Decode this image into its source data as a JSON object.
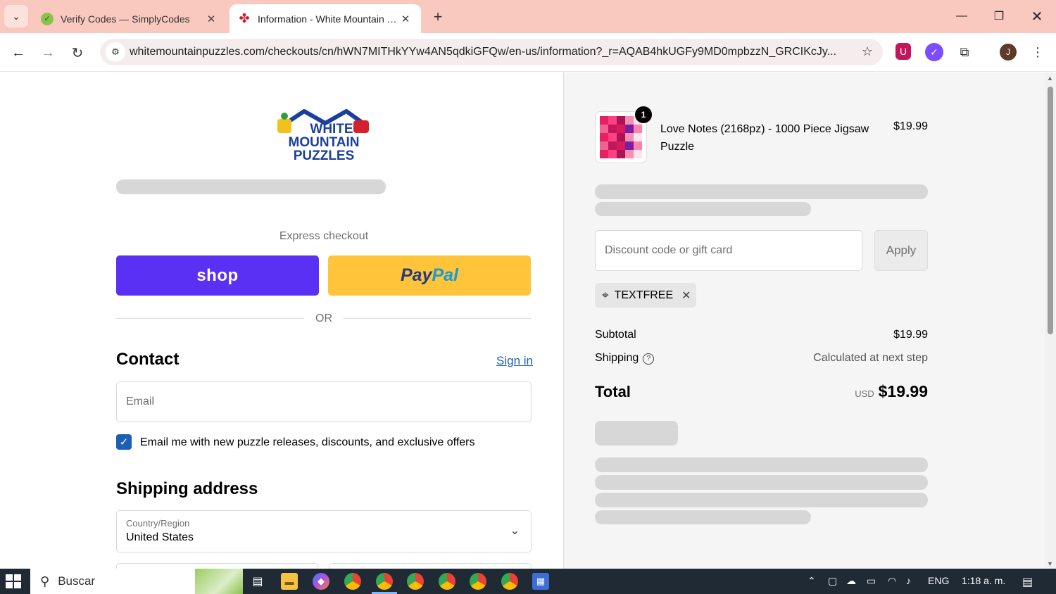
{
  "browser": {
    "tabs": [
      {
        "title": "Verify Codes — SimplyCodes",
        "active": false
      },
      {
        "title": "Information - White Mountain Puzzles",
        "active": true
      }
    ],
    "url": "whitemountainpuzzles.com/checkouts/cn/hWN7MITHkYYw4AN5qdkiGFQw/en-us/information?_r=AQAB4hkUGFy9MD0mpbzzN_GRCIKcJy...",
    "profile_initial": "J"
  },
  "checkout": {
    "logo_text": [
      "WHITE",
      "MOUNTAIN",
      "PUZZLES"
    ],
    "express_label": "Express checkout",
    "shop_label": "shop",
    "paypal_part1": "Pay",
    "paypal_part2": "Pal",
    "or_label": "OR",
    "contact_heading": "Contact",
    "sign_in_label": "Sign in",
    "email_placeholder": "Email",
    "email_optin_label": "Email me with new puzzle releases, discounts, and exclusive offers",
    "email_optin_checked": true,
    "shipping_heading": "Shipping address",
    "country_label": "Country/Region",
    "country_value": "United States"
  },
  "summary": {
    "product": {
      "name": "Love Notes (2168pz) - 1000 Piece Jigsaw Puzzle",
      "price": "$19.99",
      "quantity": "1"
    },
    "discount_placeholder": "Discount code or gift card",
    "apply_label": "Apply",
    "applied_code": "TEXTFREE",
    "subtotal_label": "Subtotal",
    "subtotal_value": "$19.99",
    "shipping_label": "Shipping",
    "shipping_value": "Calculated at next step",
    "total_label": "Total",
    "currency": "USD",
    "total_value": "$19.99"
  },
  "taskbar": {
    "search_label": "Buscar",
    "language": "ENG",
    "time": "1:18 a. m."
  },
  "colors": {
    "shop_purple": "#5a31f4",
    "paypal_yellow": "#ffc439",
    "link_blue": "#1a5fb4",
    "tab_strip": "#f9c9c0"
  }
}
